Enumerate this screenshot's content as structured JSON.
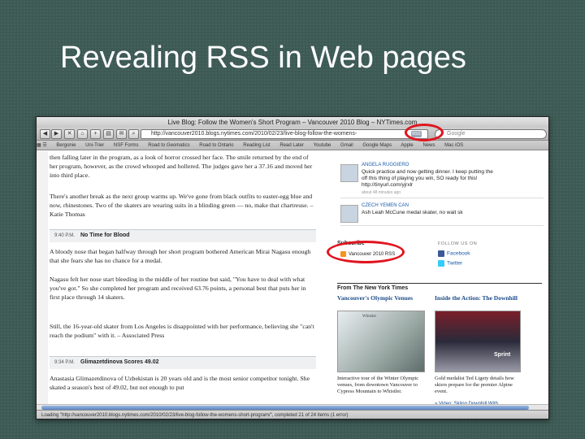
{
  "slide": {
    "title": "Revealing RSS in Web pages"
  },
  "browser": {
    "window_title": "Live Blog: Follow the Women's Short Program – Vancouver 2010 Blog – NYTimes.com",
    "address": "http://vancouver2010.blogs.nytimes.com/2010/02/23/live-blog-follow-the-womens-",
    "rss_badge": "RSS",
    "search_placeholder": "Google",
    "bookmarks": [
      "Bergonie",
      "Uni-Trier",
      "NSF Forms",
      "Road to Geomatics",
      "Road to Ontario",
      "Reading List",
      "Read Later",
      "Youtube",
      "Gmail",
      "Google Maps",
      "Apple",
      "News",
      "Mac iOS"
    ],
    "status": "Loading \"http://vancouver2010.blogs.nytimes.com/2010/02/23/live-blog-follow-the-womens-short-program/\", completed 21 of 24 items (1 error)"
  },
  "article": {
    "paragraphs": [
      "then falling later in the program, as a look of horror crossed her face. The smile returned by the end of her program, however, as the crowd whooped and hollered. The judges gave her a 37.16 and moved her into third place.",
      "There's another break as the next group warms up. We've gone from black outfits to easter-egg blue and now, rhinestones. Two of the skaters are wearing suits in a blinding green — no, make that chartreuse. – Katie Thomas"
    ],
    "entry1": {
      "time": "9:40 P.M.",
      "title": "No Time for Blood"
    },
    "entry1_paragraphs": [
      "A bloody nose that began halfway through her short program bothered American Mirai Nagasu enough that she fears she has no chance for a medal.",
      "Nagasu felt her nose start bleeding in the middle of her routine but said, \"You have to deal with what you've got.\" So she completed her program and received 63.76 points, a personal best that puts her in first place through 14 skaters.",
      "Still, the 16-year-old skater from Los Angeles is disappointed with her performance, believing she \"can't reach the podium\" with it. – Associated Press"
    ],
    "entry2": {
      "time": "9:34 P.M.",
      "title": "Glimazetdinova Scores 49.02"
    },
    "entry2_paragraphs": [
      "Anastasia Glimazetdinova of Uzbekistan is 20 years old and is the most senior competitor tonight. She skated a season's best of 49.02, but not enough to put"
    ]
  },
  "sidebar": {
    "tweets": [
      {
        "user": "ANGELA RUGGIERO",
        "text": "Quick practice and now getting dinner. I keep putting the off this thing of playing you win, SO ready for this! http://tinyurl.com/yjrxlr",
        "meta": "about 48 minutes ago"
      },
      {
        "user": "CZECH YEMEN CAN",
        "text": "Ash Leah McCune medal skater, no wait sk",
        "meta": ""
      }
    ],
    "subscribe_title": "Subscribe",
    "subscribe_link": "Vancouver 2010 RSS",
    "follow_title": "FOLLOW US ON",
    "follow_items": [
      "Facebook",
      "Twitter"
    ],
    "from_times": "From The New York Times",
    "promo1": {
      "title": "Vancouver's Olympic Venues",
      "caption": "Interactive tour of the Winter Olympic venues, from downtown Vancouver to Cypress Mountain to Whistler.",
      "map_label": "Whistler"
    },
    "promo2": {
      "title": "Inside the Action: The Downhill",
      "caption": "Gold medalist Ted Ligety details how skiers prepare for the premier Alpine event.",
      "photo_text": "Sprint",
      "video_link": "» Video: Skiing Downhill With"
    }
  },
  "colors": {
    "slide_bg": "#3d5a55",
    "highlight": "#e0141e",
    "rss_orange": "#f7941d",
    "link_blue": "#1a4a8a"
  }
}
